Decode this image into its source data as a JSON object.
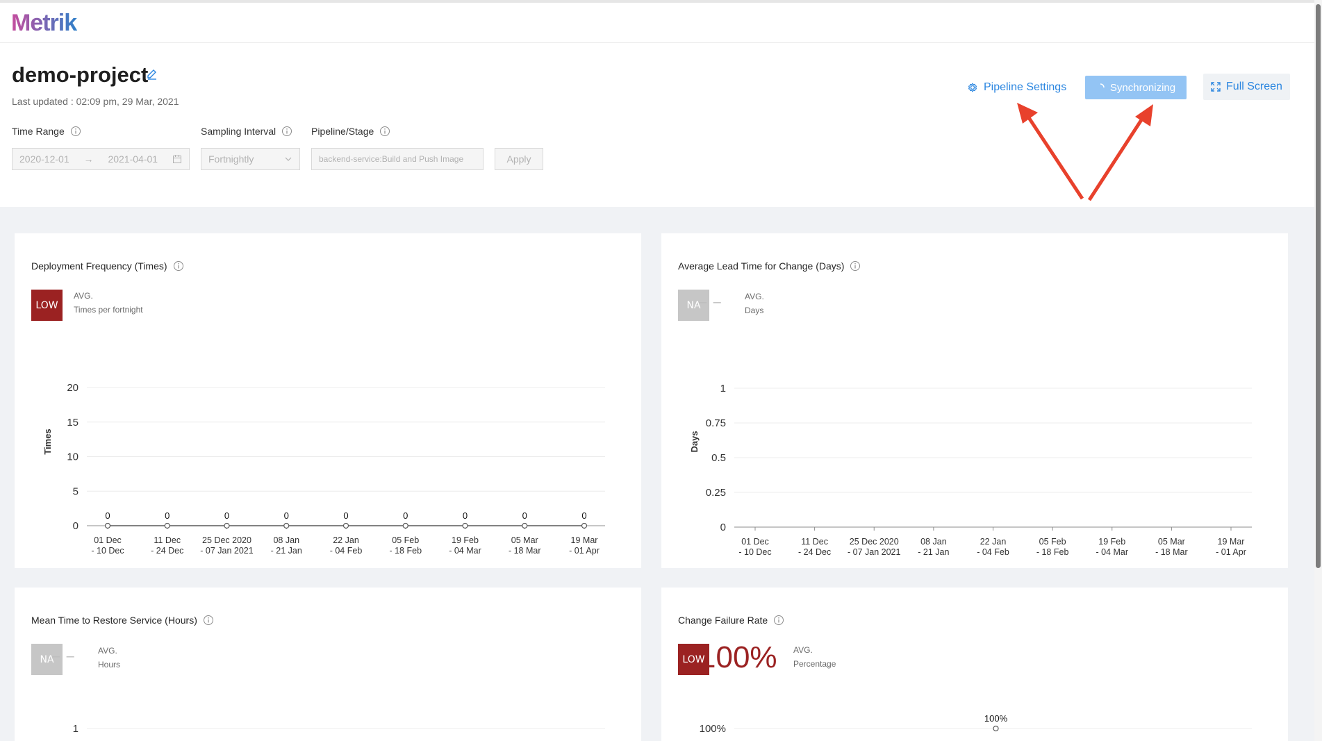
{
  "app": {
    "logo": "Metrik"
  },
  "project": {
    "name": "demo-project",
    "last_updated": "Last updated : 02:09 pm, 29 Mar, 2021"
  },
  "filters": {
    "time_range_label": "Time Range",
    "sampling_interval_label": "Sampling Interval",
    "pipeline_stage_label": "Pipeline/Stage",
    "start_date": "2020-12-01",
    "end_date": "2021-04-01",
    "interval": "Fortnightly",
    "pipeline": "backend-service:Build and Push Image",
    "apply_label": "Apply"
  },
  "actions": {
    "pipeline_settings": "Pipeline Settings",
    "synchronizing": "Synchronizing",
    "full_screen": "Full Screen"
  },
  "colors": {
    "accent": "#2b86e0",
    "low": "#9b2222",
    "na": "#c6c6c6",
    "annotation": "#e8412c"
  },
  "cards": {
    "deployment_frequency": {
      "title": "Deployment Frequency (Times)",
      "badge": "LOW",
      "avg": "AVG.",
      "unit": "Times per fortnight"
    },
    "lead_time": {
      "title": "Average Lead Time for Change (Days)",
      "badge": "NA",
      "value": "– –",
      "avg": "AVG.",
      "unit": "Days"
    },
    "mttr": {
      "title": "Mean Time to Restore Service (Hours)",
      "badge": "NA",
      "value": "– –",
      "avg": "AVG.",
      "unit": "Hours"
    },
    "change_failure": {
      "title": "Change Failure Rate",
      "badge": "LOW",
      "value": "100%",
      "avg": "AVG.",
      "unit": "Percentage"
    }
  },
  "chart_data": [
    {
      "type": "line",
      "ylabel": "Times",
      "ylim": [
        0,
        20
      ],
      "yticks": [
        "0",
        "5",
        "10",
        "15",
        "20"
      ],
      "categories": [
        [
          "01 Dec",
          "- 10 Dec"
        ],
        [
          "11 Dec",
          "- 24 Dec"
        ],
        [
          "25 Dec 2020",
          "- 07 Jan 2021"
        ],
        [
          "08 Jan",
          "- 21 Jan"
        ],
        [
          "22 Jan",
          "- 04 Feb"
        ],
        [
          "05 Feb",
          "- 18 Feb"
        ],
        [
          "19 Feb",
          "- 04 Mar"
        ],
        [
          "05 Mar",
          "- 18 Mar"
        ],
        [
          "19 Mar",
          "- 01 Apr"
        ]
      ],
      "values": [
        0,
        0,
        0,
        0,
        0,
        0,
        0,
        0,
        0
      ],
      "grid": true
    },
    {
      "type": "line",
      "ylabel": "Days",
      "ylim": [
        0,
        1
      ],
      "yticks": [
        "0",
        "0.25",
        "0.5",
        "0.75",
        "1"
      ],
      "categories": [
        [
          "01 Dec",
          "- 10 Dec"
        ],
        [
          "11 Dec",
          "- 24 Dec"
        ],
        [
          "25 Dec 2020",
          "- 07 Jan 2021"
        ],
        [
          "08 Jan",
          "- 21 Jan"
        ],
        [
          "22 Jan",
          "- 04 Feb"
        ],
        [
          "05 Feb",
          "- 18 Feb"
        ],
        [
          "19 Feb",
          "- 04 Mar"
        ],
        [
          "05 Mar",
          "- 18 Mar"
        ],
        [
          "19 Mar",
          "- 01 Apr"
        ]
      ],
      "values": [],
      "grid": true
    },
    {
      "type": "line",
      "ylabel": "",
      "yticks": [
        "1"
      ],
      "values": [],
      "grid": true
    },
    {
      "type": "line",
      "ylabel": "",
      "yticks": [
        "100%"
      ],
      "data_labels": [
        "100%"
      ],
      "values": [
        100
      ],
      "grid": true
    }
  ]
}
